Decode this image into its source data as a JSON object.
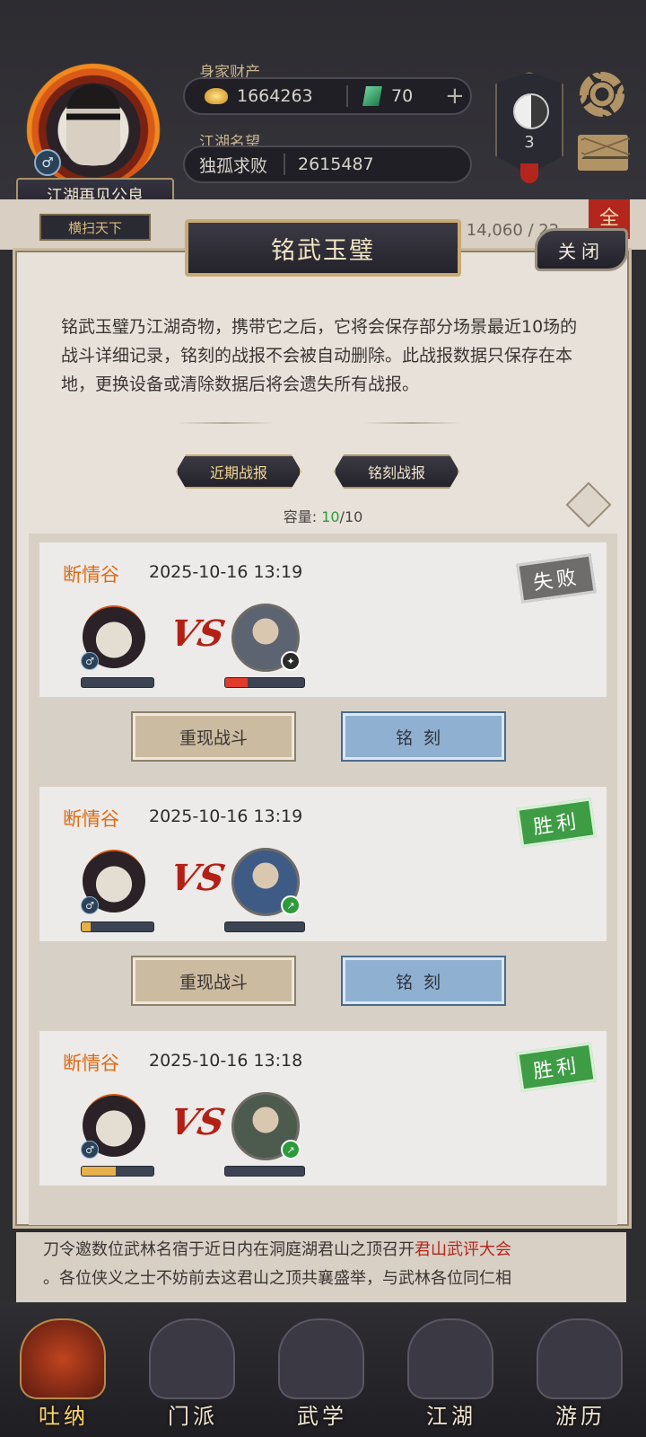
{
  "header": {
    "wealth_label": "身家财产",
    "gold": "1664263",
    "jade": "70",
    "plus": "+",
    "fame_label": "江湖名望",
    "fame_title": "独孤求败",
    "fame_value": "2615487",
    "player_name": "江湖再见公良",
    "player_title": "横扫天下",
    "gender_symbol": "♂",
    "emblem_level": "3",
    "bg_partial": "生: 14,060 / 22",
    "bg_tab": "全"
  },
  "dialog": {
    "title": "铭武玉璧",
    "close_label": "关闭",
    "description": "铭武玉璧乃江湖奇物，携带它之后，它将会保存部分场景最近10场的战斗详细记录，铭刻的战报不会被自动删除。此战报数据只保存在本地，更换设备或清除数据后将会遗失所有战报。",
    "tabs": [
      {
        "label": "近期战报",
        "active": true
      },
      {
        "label": "铭刻战报",
        "active": false
      }
    ],
    "capacity_label": "容量:",
    "capacity_current": "10",
    "capacity_max": "/10",
    "replay_label": "重现战斗",
    "engrave_label": "铭刻",
    "vs_label": "VS"
  },
  "records": [
    {
      "location": "断情谷",
      "time": "2025-10-16 13:19",
      "result": "失败",
      "player_hp": 0.0,
      "enemy_hp": 0.28,
      "enemy_color": "#5b6470",
      "enemy_badge_color": "#2b2b2b"
    },
    {
      "location": "断情谷",
      "time": "2025-10-16 13:19",
      "result": "胜利",
      "player_hp": 0.12,
      "enemy_hp": 0.0,
      "enemy_color": "#3e5b86",
      "enemy_badge_color": "#2c9b3b"
    },
    {
      "location": "断情谷",
      "time": "2025-10-16 13:18",
      "result": "胜利",
      "player_hp": 0.48,
      "enemy_hp": 0.0,
      "enemy_color": "#4d5a4e",
      "enemy_badge_color": "#2c9b3b"
    }
  ],
  "announcement": {
    "line1_prefix": "刀令邀数位武林名宿于近日内在洞庭湖君山之顶召开",
    "line1_highlight": "君山武评大会",
    "line2": "。各位侠义之士不妨前去这君山之顶共襄盛举，与武林各位同仁相"
  },
  "nav": [
    {
      "label": "吐纳",
      "active": true
    },
    {
      "label": "门派",
      "active": false
    },
    {
      "label": "武学",
      "active": false
    },
    {
      "label": "江湖",
      "active": false
    },
    {
      "label": "游历",
      "active": false
    }
  ],
  "colors": {
    "loss_stamp": "#6f6d6b",
    "win_stamp": "#3e9c45",
    "location_text": "#e06a14",
    "capacity_current": "#2c9b3b",
    "hp_player_fill": "#e7b04a",
    "hp_enemy_fill": "#e23b2a"
  }
}
